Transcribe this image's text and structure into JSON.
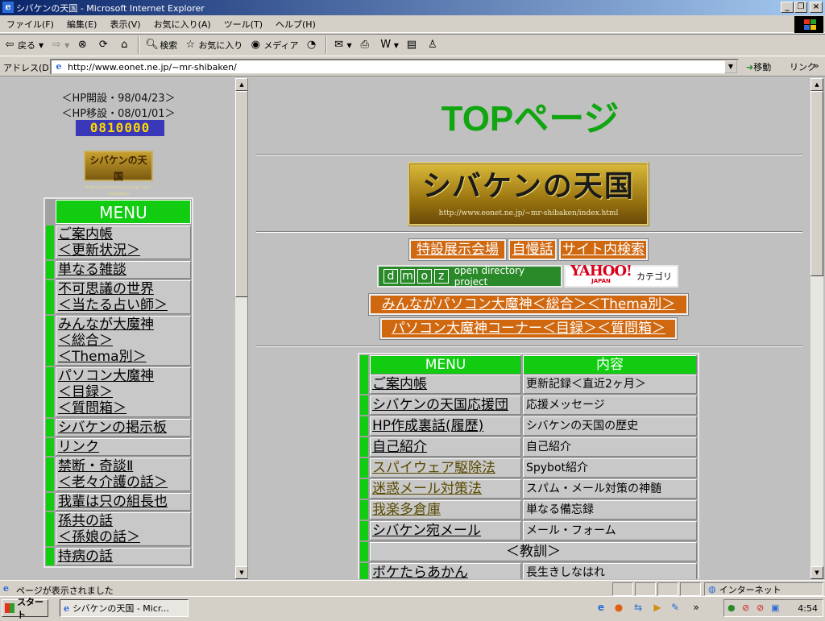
{
  "window": {
    "title": "シバケンの天国 - Microsoft Internet Explorer",
    "minimize": "_",
    "maximize": "❐",
    "close": "×"
  },
  "menubar": [
    "ファイル(F)",
    "編集(E)",
    "表示(V)",
    "お気に入り(A)",
    "ツール(T)",
    "ヘルプ(H)"
  ],
  "toolbar": {
    "back": "戻る",
    "search": "検索",
    "favorites": "お気に入り",
    "media": "メディア"
  },
  "address": {
    "label": "アドレス(D)",
    "url": "http://www.eonet.ne.jp/~mr-shibaken/",
    "go": "移動",
    "links": "リンク"
  },
  "left": {
    "opened": "＜HP開設・98/04/23＞",
    "moved": "＜HP移設・08/01/01＞",
    "counter": "0810000",
    "logo_name": "シバケンの天国",
    "logo_url": "http://www.eonet.ne.jp/~mr-shibaken/",
    "menu_title": "MENU",
    "menu_items": [
      [
        "ご案内帳",
        "＜更新状況＞"
      ],
      [
        "単なる雑談"
      ],
      [
        "不可思議の世界",
        "＜当たる占い師＞"
      ],
      [
        "みんなが大魔神",
        "＜総合＞",
        "＜Thema別＞"
      ],
      [
        "パソコン大魔神",
        "＜目録＞",
        "＜質問箱＞"
      ],
      [
        "シバケンの掲示板"
      ],
      [
        "リンク"
      ],
      [
        "禁断・奇談Ⅱ",
        "＜老々介護の話＞"
      ],
      [
        "我輩は只の組長也"
      ],
      [
        "孫共の話",
        "＜孫娘の話＞"
      ],
      [
        "持病の話"
      ]
    ]
  },
  "main": {
    "title": "TOPページ",
    "logo_name": "シバケンの天国",
    "logo_url": "http://www.eonet.ne.jp/~mr-shibaken/index.html",
    "buttons_row1": [
      "特設展示会場",
      "自慢話",
      "サイト内検索"
    ],
    "dmoz_letters": [
      "d",
      "m",
      "o",
      "z"
    ],
    "dmoz_text": "open directory project",
    "yahoo_logo": "YAHOO!",
    "yahoo_sub": "JAPAN",
    "yahoo_category": "カテゴリ",
    "button_row3": "みんながパソコン大魔神＜総合＞＜Thema別＞",
    "button_row4": "パソコン大魔神コーナー＜目録＞＜質問箱＞",
    "table": {
      "headers": [
        "MENU",
        "内容"
      ],
      "rows": [
        [
          "ご案内帳",
          "更新記録＜直近2ヶ月＞"
        ],
        [
          "シバケンの天国応援団",
          "応援メッセージ"
        ],
        [
          "HP作成裏話(履歴)",
          "シバケンの天国の歴史"
        ],
        [
          "自己紹介",
          "自己紹介"
        ],
        [
          "スパイウェア駆除法",
          "Spybot紹介"
        ],
        [
          "迷惑メール対策法",
          "スパム・メール対策の神髄"
        ],
        [
          "我楽多倉庫",
          "単なる備忘録"
        ],
        [
          "シバケン宛メール",
          "メール・フォーム"
        ]
      ],
      "section": "＜教訓＞",
      "after_rows": [
        [
          "ボケたらあかん",
          "長生きしなはれ"
        ]
      ]
    }
  },
  "status": {
    "text": "ページが表示されました",
    "zone": "インターネット"
  },
  "taskbar": {
    "start": "スタート",
    "item": "シバケンの天国 - Micr...",
    "clock": "4:54"
  },
  "colors": {
    "green": "#11cc11",
    "title_green": "#11a511",
    "orange": "#d06810",
    "counter_bg": "#3838b8",
    "counter_fg": "#ffd800"
  }
}
